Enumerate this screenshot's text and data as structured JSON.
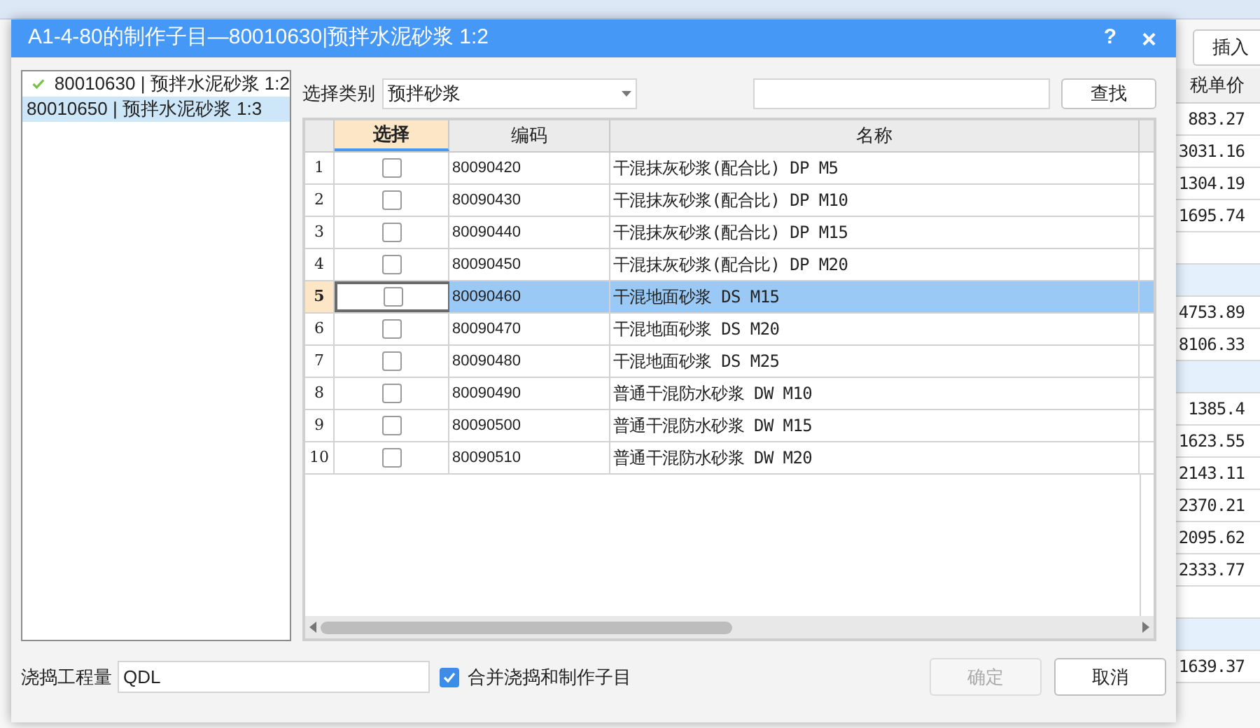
{
  "background": {
    "button": "插入",
    "column_header": "税单价",
    "rows": [
      {
        "value": "883.27",
        "selected": false
      },
      {
        "value": "3031.16",
        "selected": false
      },
      {
        "value": "1304.19",
        "selected": false
      },
      {
        "value": "1695.74",
        "selected": false
      },
      {
        "value": "",
        "selected": false
      },
      {
        "value": "",
        "selected": true
      },
      {
        "value": "4753.89",
        "selected": false
      },
      {
        "value": "8106.33",
        "selected": false
      },
      {
        "value": "",
        "selected": true
      },
      {
        "value": "1385.4",
        "selected": false
      },
      {
        "value": "1623.55",
        "selected": false
      },
      {
        "value": "2143.11",
        "selected": false
      },
      {
        "value": "2370.21",
        "selected": false
      },
      {
        "value": "2095.62",
        "selected": false
      },
      {
        "value": "2333.77",
        "selected": false
      },
      {
        "value": "",
        "selected": false
      },
      {
        "value": "",
        "selected": true
      },
      {
        "value": "1639.37",
        "selected": false
      }
    ]
  },
  "dialog": {
    "title": "A1-4-80的制作子目—80010630|预拌水泥砂浆 1:2",
    "help": "?",
    "close": "×",
    "items": [
      {
        "label": "80010630 | 预拌水泥砂浆 1:2",
        "checked": true,
        "selected": false
      },
      {
        "label": "80010650 | 预拌水泥砂浆 1:3",
        "checked": false,
        "selected": true
      }
    ],
    "category_label": "选择类别",
    "category_value": "预拌砂浆",
    "search_button": "查找",
    "table": {
      "columns": [
        {
          "label": "选择",
          "selected": true
        },
        {
          "label": "编码",
          "selected": false
        },
        {
          "label": "名称",
          "selected": false
        }
      ],
      "rows": [
        {
          "num": "1",
          "checked": false,
          "code": "80090420",
          "name": "干混抹灰砂浆(配合比) DP M5",
          "selected": false
        },
        {
          "num": "2",
          "checked": false,
          "code": "80090430",
          "name": "干混抹灰砂浆(配合比) DP M10",
          "selected": false
        },
        {
          "num": "3",
          "checked": false,
          "code": "80090440",
          "name": "干混抹灰砂浆(配合比) DP M15",
          "selected": false
        },
        {
          "num": "4",
          "checked": false,
          "code": "80090450",
          "name": "干混抹灰砂浆(配合比) DP M20",
          "selected": false
        },
        {
          "num": "5",
          "checked": false,
          "code": "80090460",
          "name": "干混地面砂浆 DS M15",
          "selected": true
        },
        {
          "num": "6",
          "checked": false,
          "code": "80090470",
          "name": "干混地面砂浆 DS M20",
          "selected": false
        },
        {
          "num": "7",
          "checked": false,
          "code": "80090480",
          "name": "干混地面砂浆 DS M25",
          "selected": false
        },
        {
          "num": "8",
          "checked": false,
          "code": "80090490",
          "name": "普通干混防水砂浆 DW M10",
          "selected": false
        },
        {
          "num": "9",
          "checked": false,
          "code": "80090500",
          "name": "普通干混防水砂浆 DW M15",
          "selected": false
        },
        {
          "num": "10",
          "checked": false,
          "code": "80090510",
          "name": "普通干混防水砂浆 DW M20",
          "selected": false
        }
      ]
    },
    "quantity_label": "浇捣工程量",
    "quantity_value": "QDL",
    "merge": {
      "label": "合并浇捣和制作子目",
      "checked": true
    },
    "buttons": [
      {
        "label": "确定",
        "disabled": true
      },
      {
        "label": "取消",
        "disabled": false
      }
    ]
  }
}
